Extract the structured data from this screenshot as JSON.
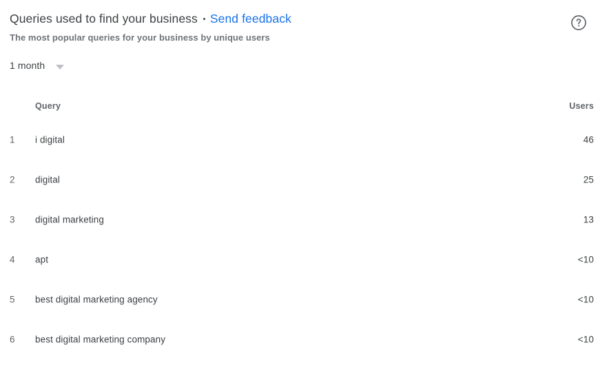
{
  "header": {
    "title": "Queries used to find your business",
    "separator": "•",
    "feedback_label": "Send feedback",
    "subtitle": "The most popular queries for your business by unique users",
    "help_icon": "help-circle-icon",
    "link_color": "#1a73e8",
    "title_color": "#3c4043",
    "subtitle_color": "#70757a"
  },
  "range_selector": {
    "value": "1 month",
    "caret_icon": "chevron-down-icon"
  },
  "table": {
    "columns": [
      "Query",
      "Users"
    ],
    "rows": [
      {
        "rank": "1",
        "query": "i digital",
        "users": "46"
      },
      {
        "rank": "2",
        "query": "digital",
        "users": "25"
      },
      {
        "rank": "3",
        "query": "digital marketing",
        "users": "13"
      },
      {
        "rank": "4",
        "query": "apt",
        "users": "<10"
      },
      {
        "rank": "5",
        "query": "best digital marketing agency",
        "users": "<10"
      },
      {
        "rank": "6",
        "query": "best digital marketing company",
        "users": "<10"
      }
    ]
  }
}
